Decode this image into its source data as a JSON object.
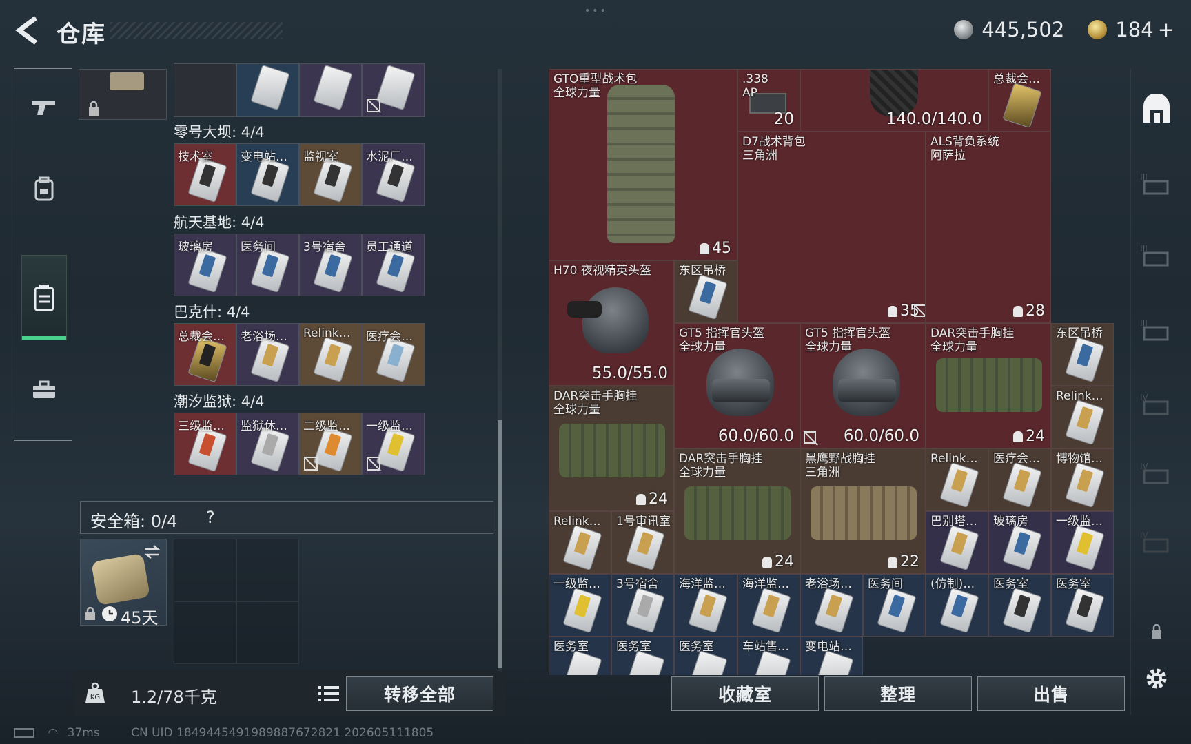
{
  "header": {
    "title": "仓库",
    "silver": "445,502",
    "gold": "184",
    "gold_plus": "+"
  },
  "left": {
    "groups": [
      {
        "name": "零号大坝: 4/4",
        "slots": [
          "技术室",
          "变电站…",
          "监视室",
          "水泥厂…"
        ]
      },
      {
        "name": "航天基地: 4/4",
        "slots": [
          "玻璃房",
          "医务间",
          "3号宿舍",
          "员工通道"
        ]
      },
      {
        "name": "巴克什: 4/4",
        "slots": [
          "总裁会…",
          "老浴场…",
          "Relink…",
          "医疗会…"
        ]
      },
      {
        "name": "潮汐监狱: 4/4",
        "slots": [
          "三级监…",
          "监狱休…",
          "二级监…",
          "一级监…"
        ]
      }
    ],
    "safebox_label": "安全箱:  0/4",
    "safebox_help": "?",
    "safe_item_days": "45天",
    "weight": "1.2/78千克",
    "transfer_all": "转移全部"
  },
  "right": {
    "items": {
      "gto": "GTO重型战术包\n全球力量",
      "gto_cnt": "45",
      "ap338": ".338\nAP",
      "ap338_cnt": "20",
      "dur1": "140.0/140.0",
      "ceo": "总裁会…",
      "d7": "D7战术背包\n三角洲",
      "d7_cnt": "35",
      "als": "ALS背负系统\n阿萨拉",
      "als_cnt": "28",
      "h70": "H70 夜视精英头盔",
      "h70_dur": "55.0/55.0",
      "eastbridge1": "东区吊桥",
      "gt5a": "GT5 指挥官头盔\n全球力量",
      "gt5a_dur": "60.0/60.0",
      "gt5b": "GT5 指挥官头盔\n全球力量",
      "gt5b_dur": "60.0/60.0",
      "dar1": "DAR突击手胸挂\n全球力量",
      "dar1_cnt": "24",
      "eastbridge2": "东区吊桥",
      "dar2": "DAR突击手胸挂\n全球力量",
      "dar2_cnt": "24",
      "relink1": "Relink…",
      "dar3": "DAR突击手胸挂\n全球力量",
      "dar3_cnt": "24",
      "blackhawk": "黑鹰野战胸挂\n三角洲",
      "blackhawk_cnt": "22",
      "relink2": "Relink…",
      "medical": "医疗会…",
      "museum": "博物馆…",
      "relink3": "Relink…",
      "comm1": "1号审讯室",
      "babel": "巴别塔…",
      "glass": "玻璃房",
      "level1a": "一级监…",
      "row8": [
        "一级监…",
        "3号宿舍",
        "海洋监…",
        "海洋监…",
        "老浴场…",
        "医务间",
        "(仿制)…",
        "医务室",
        "医务室"
      ],
      "row9": [
        "医务室",
        "医务室",
        "医务室",
        "车站售…",
        "变电站…"
      ]
    },
    "btn_collection": "收藏室",
    "btn_sort": "整理",
    "btn_sell": "出售"
  },
  "status": {
    "ping": "37ms",
    "uid": "CN UID 1849445491989887672821  202605111805"
  },
  "colors": {
    "accent_green": "#49d08a",
    "item_red": "#5a272c",
    "item_blue": "#253448"
  }
}
